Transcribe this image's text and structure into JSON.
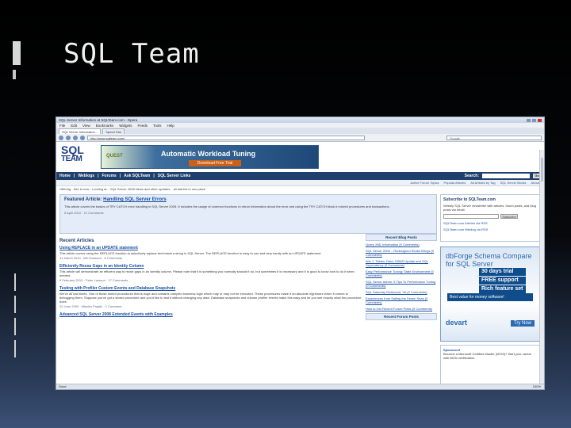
{
  "slide": {
    "title": "SQL Team"
  },
  "browser": {
    "window_title": "SQL Server Information at SQLTeam.com - Opera",
    "menu": [
      "File",
      "Edit",
      "View",
      "Bookmarks",
      "Widgets",
      "Feeds",
      "Tools",
      "Help"
    ],
    "tabs": [
      "SQL Server Information...",
      "Speed Dial"
    ],
    "url": "http://www.sqlteam.com/",
    "search_placeholder": "Google",
    "status_text": "Done",
    "zoom": "100%"
  },
  "site": {
    "logo_line1": "SQL",
    "logo_line2": "TEAM",
    "banner": {
      "brand": "QUEST",
      "title": "Automatic Workload Tuning",
      "button": "Download Free Trial"
    },
    "nav": [
      "Home",
      "Weblogs",
      "Forums",
      "Ask SQLTeam",
      "SQL Server Links"
    ],
    "search_label": "Search:",
    "go_label": "Go",
    "subnav": [
      "Active Forum Topics",
      "Popular Articles",
      "All Articles by Tag",
      "SQL Server Books",
      "About"
    ],
    "ticker_label": "Offering",
    "ticker_text": "Offering - free to new - Looking at... SQL Server 2008 News and other updates... all articles in one place",
    "featured": {
      "label": "Featured Article:",
      "link": "Handling SQL Server Errors",
      "text": "This article covers the basics of TRY CATCH error handling in SQL Server 2005. It includes the usage of common functions to return information about the error and using the TRY CATCH block in stored procedures and transactions.",
      "meta": "5 April 2010 · 21 Comments"
    },
    "recent_heading": "Recent Articles",
    "articles": [
      {
        "title": "Using REPLACE in an UPDATE statement",
        "desc": "This article covers using the REPLACE function to selectively replace text inside a string in SQL Server. The REPLACE function is easy to use and very handy with an UPDATE statement.",
        "meta": "31 March 2010 · Bill Graziano · 8 Comments"
      },
      {
        "title": "Efficiently Reuse Gaps in an Identity Column",
        "desc": "This article will demonstrate an efficient way to reuse gaps in an identity column. Please note that it is something you normally shouldn't do, but sometimes it is necessary and it is good to know how to do it when needed.",
        "meta": "9 February 2010 · Peter Larsson · 17 Comments"
      },
      {
        "title": "Testing with Profiler Custom Events and Database Snapshots",
        "desc": "We've all had times. One of those stored procedures that is huge and contains complex business logic which may or may not be executed. These procedures make it an absolute nightmare when it comes to debugging them. Suppose you've got a stored procedure and you'd like to test it without changing any data. Database snapshots and custom profiler events make this easy and let you see exactly what the procedure does.",
        "meta": "22 June 2009 · Mladen Prajdić · 1 Comment"
      },
      {
        "title": "Advanced SQL Server 2008 Extended Events with Examples",
        "desc": "",
        "meta": ""
      }
    ],
    "blog_heading": "Recent Blog Posts",
    "blog_posts": [
      "Query XML Information (0 Comments)",
      "SQL Server 2008 – Redesigned Studio Brings (0 Comments)",
      "Win 7, Tables, Data, SSMS Update and SQL Dependency (0 Comments)",
      "Easy Performance Tuning: State Environment (0 Comments)",
      "SQL Server Admin: 5 Tips To Performance Tuning (0 Comments)",
      "SQL Saturday Richmond, VA (0 Comments)",
      "Experiences from Sailing the Seven Seas (0 Comments)",
      "How to Get Recent Forum Posts (0 Comments)"
    ],
    "forum_heading": "Recent Forum Posts",
    "subscribe": {
      "title": "Subscribe to SQLTeam.com",
      "text": "Weekly SQL Server newsletter with articles, forum posts, and blog posts via email.",
      "button": "Subscribe",
      "rss1": "SQLTeam.com Articles via RSS",
      "rss2": "SQLTeam.com Weblog via RSS"
    },
    "ad": {
      "title": "dbForge Schema Compare for SQL Server",
      "bullets": [
        "30 days trial",
        "FREE support",
        "Rich feature set"
      ],
      "tagline": "Best value for money software!",
      "brand": "devart",
      "try": "Try Now"
    },
    "ad2": {
      "title": "Sponsored",
      "text": "Become a Microsoft Certified Master (MCM)? Start your career with MCM certification."
    }
  }
}
